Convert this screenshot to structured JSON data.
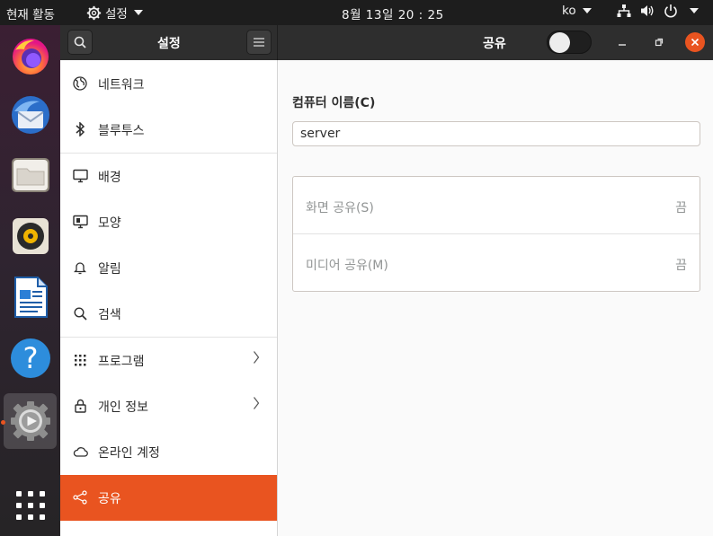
{
  "topbar": {
    "activities": "현재 활동",
    "app_menu": "설정",
    "clock": "8월 13일  20 : 25",
    "input_method": "ko"
  },
  "dock": {
    "items": [
      {
        "name": "firefox",
        "icon": "firefox-icon"
      },
      {
        "name": "thunderbird",
        "icon": "thunderbird-icon"
      },
      {
        "name": "files",
        "icon": "files-icon"
      },
      {
        "name": "rhythmbox",
        "icon": "rhythmbox-icon"
      },
      {
        "name": "libreoffice-writer",
        "icon": "writer-icon"
      },
      {
        "name": "help",
        "icon": "help-icon",
        "glyph": "?"
      },
      {
        "name": "settings",
        "icon": "settings-icon",
        "active": true
      },
      {
        "name": "show-applications",
        "icon": "app-grid-icon"
      }
    ]
  },
  "headerbar": {
    "sidebar_title": "설정",
    "page_title": "공유",
    "sharing_switch": false
  },
  "sidebar": {
    "items": [
      {
        "label": "네트워크",
        "icon": "globe-icon"
      },
      {
        "label": "블루투스",
        "icon": "bluetooth-icon"
      },
      {
        "label": "배경",
        "icon": "monitor-icon"
      },
      {
        "label": "모양",
        "icon": "appearance-icon"
      },
      {
        "label": "알림",
        "icon": "bell-icon"
      },
      {
        "label": "검색",
        "icon": "search-icon"
      },
      {
        "label": "프로그램",
        "icon": "grid-icon",
        "chevron": true
      },
      {
        "label": "개인 정보",
        "icon": "lock-icon",
        "chevron": true
      },
      {
        "label": "온라인 계정",
        "icon": "cloud-icon"
      },
      {
        "label": "공유",
        "icon": "share-icon",
        "selected": true
      }
    ]
  },
  "content": {
    "computer_name_label": "컴퓨터 이름(C)",
    "computer_name_value": "server",
    "rows": [
      {
        "label": "화면 공유(S)",
        "value": "끔"
      },
      {
        "label": "미디어 공유(M)",
        "value": "끔"
      }
    ]
  },
  "colors": {
    "accent": "#e95420",
    "headerbar": "#2e2e2e",
    "topbar": "#1d1d1d"
  }
}
